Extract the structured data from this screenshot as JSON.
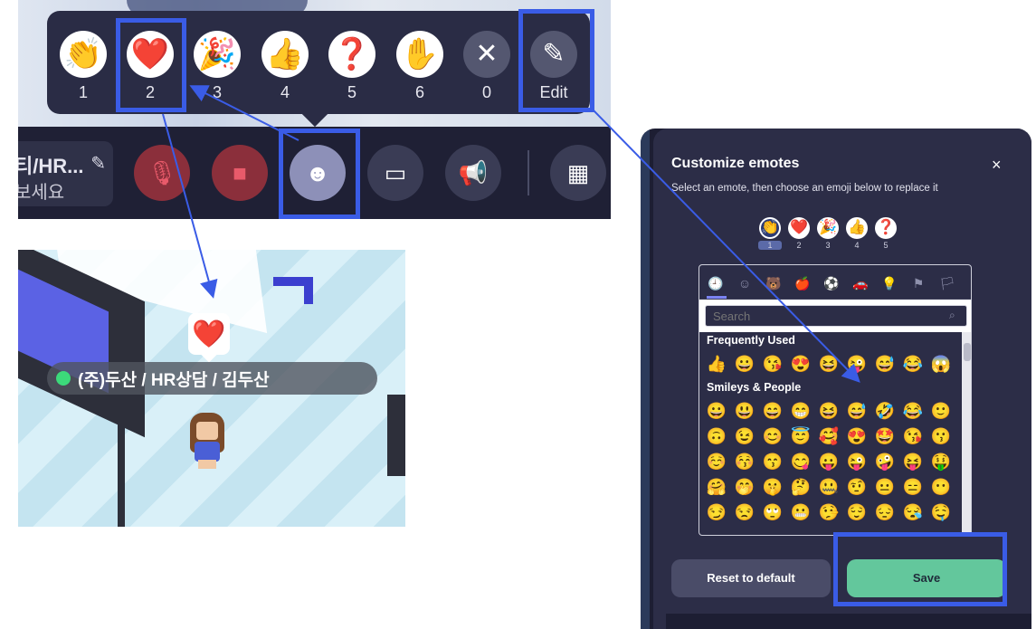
{
  "emote_bar": {
    "emotes": [
      {
        "emoji": "👏",
        "number": "1"
      },
      {
        "emoji": "❤️",
        "number": "2"
      },
      {
        "emoji": "🎉",
        "number": "3"
      },
      {
        "emoji": "👍",
        "number": "4"
      },
      {
        "emoji": "❓",
        "number": "5"
      },
      {
        "emoji": "✋",
        "number": "6"
      }
    ],
    "clear": {
      "symbol": "✕",
      "number": "0"
    },
    "edit": {
      "symbol": "✎",
      "label": "Edit"
    }
  },
  "toolbar": {
    "name_line1": "티/HR...",
    "name_line2": "보세요",
    "pencil_symbol": "✎",
    "mic_symbol": "🎙",
    "camera_symbol": "■",
    "emote_symbol": "☻",
    "screen_symbol": "▭",
    "megaphone_symbol": "📢",
    "map_symbol": "▦"
  },
  "map": {
    "bubble_emoji": "❤️",
    "player_name": "(주)두산 / HR상담 / 김두산"
  },
  "dialog": {
    "title": "Customize emotes",
    "close": "×",
    "subtitle": "Select an emote, then choose an emoji below to replace it",
    "slots": [
      {
        "emoji": "👏",
        "number": "1"
      },
      {
        "emoji": "❤️",
        "number": "2"
      },
      {
        "emoji": "🎉",
        "number": "3"
      },
      {
        "emoji": "👍",
        "number": "4"
      },
      {
        "emoji": "❓",
        "number": "5"
      }
    ],
    "categories": [
      "🕘",
      "☺",
      "🐻",
      "🍎",
      "⚽",
      "🚗",
      "💡",
      "⚑",
      "🏳"
    ],
    "search_placeholder": "Search",
    "search_icon": "⌕",
    "frequently_used_title": "Frequently Used",
    "frequently_used": [
      "👍",
      "😀",
      "😘",
      "😍",
      "😆",
      "😜",
      "😅",
      "😂",
      "😱"
    ],
    "smileys_title": "Smileys & People",
    "smileys": [
      [
        "😀",
        "😃",
        "😄",
        "😁",
        "😆",
        "😅",
        "🤣",
        "😂",
        "🙂"
      ],
      [
        "🙃",
        "😉",
        "😊",
        "😇",
        "🥰",
        "😍",
        "🤩",
        "😘",
        "😗"
      ],
      [
        "☺️",
        "😚",
        "😙",
        "😋",
        "😛",
        "😜",
        "🤪",
        "😝",
        "🤑"
      ],
      [
        "🤗",
        "🤭",
        "🤫",
        "🤔",
        "🤐",
        "🤨",
        "😐",
        "😑",
        "😶"
      ],
      [
        "😏",
        "😒",
        "🙄",
        "😬",
        "🤥",
        "😌",
        "😔",
        "😪",
        "🤤"
      ]
    ],
    "reset_label": "Reset to default",
    "save_label": "Save"
  },
  "annotation_color": "#3a5ce6"
}
